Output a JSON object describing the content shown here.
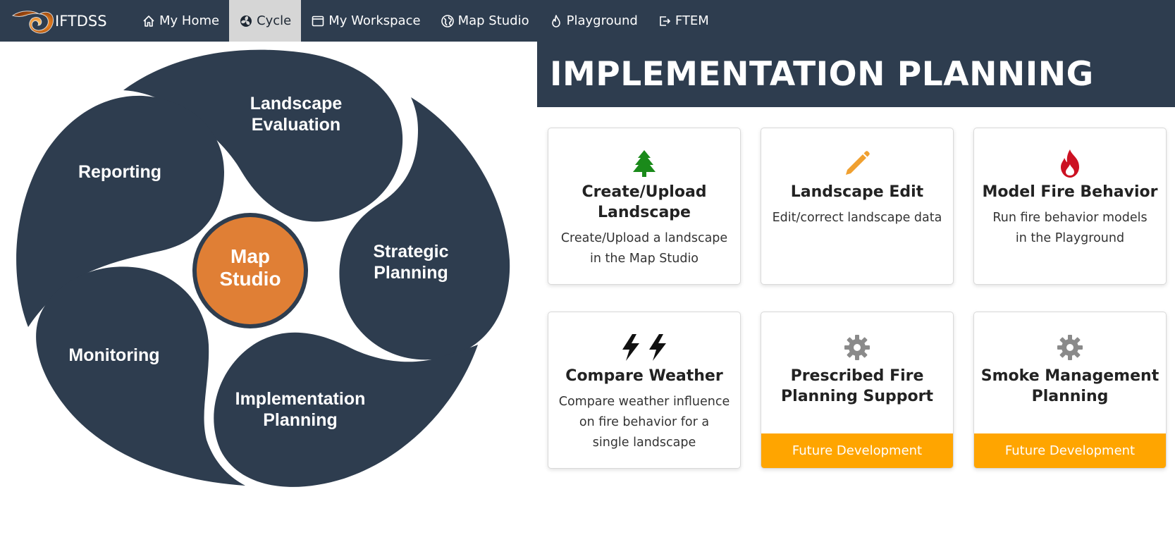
{
  "nav": {
    "brand": "IFTDSS",
    "items": [
      {
        "label": "My Home",
        "icon": "home-icon",
        "active": false
      },
      {
        "label": "Cycle",
        "icon": "cycle-icon",
        "active": true
      },
      {
        "label": "My Workspace",
        "icon": "window-icon",
        "active": false
      },
      {
        "label": "Map Studio",
        "icon": "globe-icon",
        "active": false
      },
      {
        "label": "Playground",
        "icon": "fire-icon",
        "active": false
      },
      {
        "label": "FTEM",
        "icon": "export-icon",
        "active": false
      }
    ]
  },
  "cycle": {
    "center": {
      "line1": "Map",
      "line2": "Studio",
      "color": "#e07f35"
    },
    "landscape_evaluation": {
      "line1": "Landscape",
      "line2": "Evaluation"
    },
    "strategic_planning": {
      "line1": "Strategic",
      "line2": "Planning"
    },
    "implementation_planning": {
      "line1": "Implementation",
      "line2": "Planning"
    },
    "monitoring": {
      "line1": "Monitoring"
    },
    "reporting": {
      "line1": "Reporting"
    },
    "petal_color": "#2e3d4f"
  },
  "page": {
    "title": "IMPLEMENTATION PLANNING"
  },
  "cards": {
    "create_upload": {
      "icon": "tree-icon",
      "title_line1": "Create/Upload",
      "title_line2": "Landscape",
      "desc_line1": "Create/Upload a landscape",
      "desc_line2": "in the Map Studio",
      "icon_color": "#1a8a1a"
    },
    "landscape_edit": {
      "icon": "pencil-icon",
      "title_line1": "Landscape Edit",
      "desc_line1": "Edit/correct landscape data",
      "icon_color": "#f0a030"
    },
    "model_fire": {
      "icon": "fire-icon",
      "title_line1": "Model Fire Behavior",
      "desc_line1": "Run fire behavior models",
      "desc_line2": "in the Playground",
      "icon_color": "#cc1122"
    },
    "compare_weather": {
      "icon": "lightning-icon",
      "title_line1": "Compare Weather",
      "desc_line1": "Compare weather influence",
      "desc_line2": "on fire behavior for a",
      "desc_line3": "single landscape"
    },
    "prescribed_fire": {
      "icon": "gear-icon",
      "title_line1": "Prescribed Fire",
      "title_line2": "Planning Support",
      "footer": "Future Development"
    },
    "smoke_management": {
      "icon": "gear-icon",
      "title_line1": "Smoke Management",
      "title_line2": "Planning",
      "footer": "Future Development"
    }
  }
}
